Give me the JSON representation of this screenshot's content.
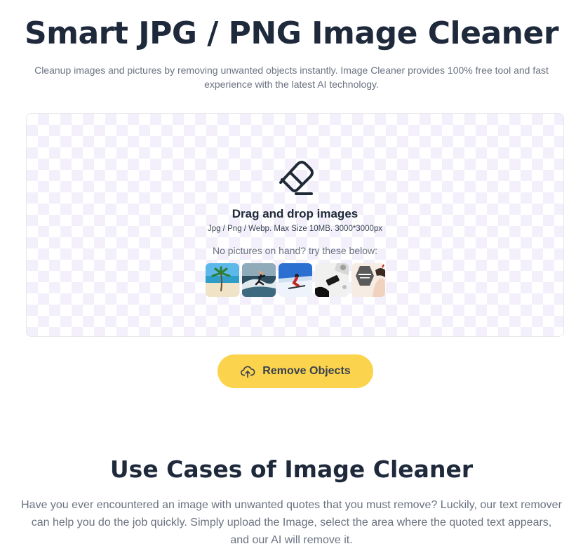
{
  "hero": {
    "title": "Smart JPG / PNG Image Cleaner",
    "subtitle": "Cleanup images and pictures by removing unwanted objects instantly. Image Cleaner provides 100% free tool and fast experience with the latest AI technology."
  },
  "upload": {
    "icon": "eraser-icon",
    "title": "Drag and drop images",
    "hint": "Jpg / Png / Webp. Max Size 10MB. 3000*3000px",
    "sample_label": "No pictures on hand? try these below:",
    "samples": [
      {
        "name": "beach-palm-sample"
      },
      {
        "name": "surfer-wave-sample"
      },
      {
        "name": "skier-snow-sample"
      },
      {
        "name": "desk-phone-sample"
      },
      {
        "name": "person-poster-sample"
      }
    ]
  },
  "action": {
    "label": "Remove Objects",
    "icon": "cloud-upload-icon",
    "color": "#fcd34d"
  },
  "use_cases": {
    "title": "Use Cases of Image Cleaner",
    "text": "Have you ever encountered an image with unwanted quotes that you must remove? Luckily, our text remover can help you do the job quickly. Simply upload the Image, select the area where the quoted text appears, and our AI will remove it."
  }
}
